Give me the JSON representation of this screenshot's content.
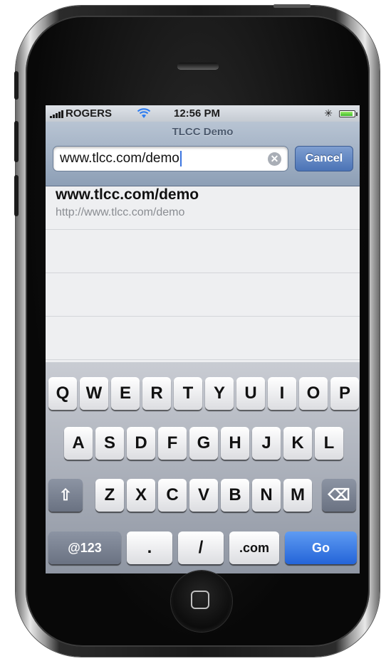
{
  "status_bar": {
    "carrier": "ROGERS",
    "time": "12:56 PM",
    "bluetooth": "✳",
    "signal_bars": 5,
    "battery_level": 0.9
  },
  "browser": {
    "title": "TLCC Demo",
    "url_value": "www.tlcc.com/demo",
    "clear_glyph": "✕",
    "cancel_label": "Cancel"
  },
  "suggestions": [
    {
      "title": "www.tlcc.com/demo",
      "url": "http://www.tlcc.com/demo"
    }
  ],
  "keyboard": {
    "row1": [
      "Q",
      "W",
      "E",
      "R",
      "T",
      "Y",
      "U",
      "I",
      "O",
      "P"
    ],
    "row2": [
      "A",
      "S",
      "D",
      "F",
      "G",
      "H",
      "J",
      "K",
      "L"
    ],
    "row3": [
      "Z",
      "X",
      "C",
      "V",
      "B",
      "N",
      "M"
    ],
    "shift_glyph": "⇧",
    "backspace_glyph": "⌫",
    "numbers_label": "@123",
    "dot_label": ".",
    "slash_label": "/",
    "dotcom_label": ".com",
    "go_label": "Go"
  },
  "colors": {
    "go_key": "#2464d8",
    "cancel_button": "#4b73b6",
    "url_bar": "#8d9fb6"
  }
}
